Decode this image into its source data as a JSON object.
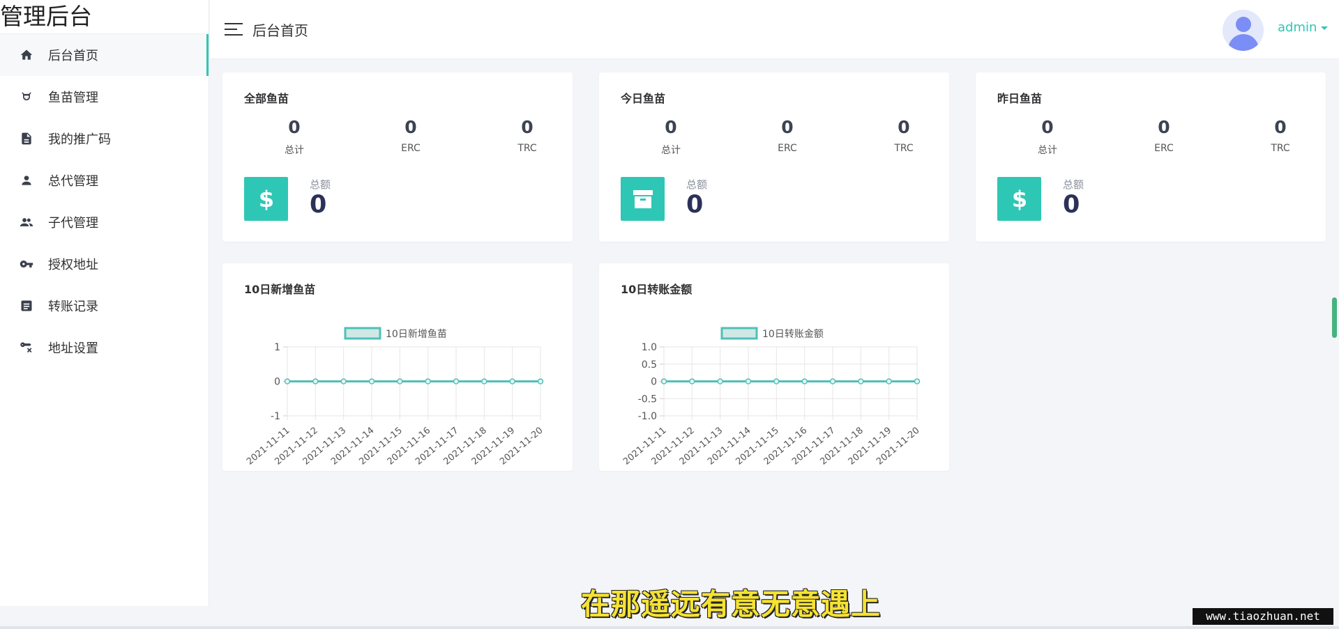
{
  "app": {
    "logo": "管理后台"
  },
  "sidebar": {
    "items": [
      {
        "label": "后台首页",
        "icon": "home-icon",
        "active": true
      },
      {
        "label": "鱼苗管理",
        "icon": "cow-icon"
      },
      {
        "label": "我的推广码",
        "icon": "document-icon"
      },
      {
        "label": "总代管理",
        "icon": "person-icon"
      },
      {
        "label": "子代管理",
        "icon": "people-icon"
      },
      {
        "label": "授权地址",
        "icon": "key-icon"
      },
      {
        "label": "转账记录",
        "icon": "list-box-icon"
      },
      {
        "label": "地址设置",
        "icon": "wrench-cross-icon"
      }
    ]
  },
  "header": {
    "title": "后台首页",
    "user": "admin"
  },
  "colors": {
    "accent": "#2ec7b5",
    "avatar": "#7b8ef5"
  },
  "stat_cards": [
    {
      "title": "全部鱼苗",
      "icon": "dollar-icon",
      "stats": [
        {
          "value": "0",
          "label": "总计"
        },
        {
          "value": "0",
          "label": "ERC"
        },
        {
          "value": "0",
          "label": "TRC"
        }
      ],
      "total_label": "总额",
      "total_value": "0"
    },
    {
      "title": "今日鱼苗",
      "icon": "archive-icon",
      "stats": [
        {
          "value": "0",
          "label": "总计"
        },
        {
          "value": "0",
          "label": "ERC"
        },
        {
          "value": "0",
          "label": "TRC"
        }
      ],
      "total_label": "总额",
      "total_value": "0"
    },
    {
      "title": "昨日鱼苗",
      "icon": "dollar-icon",
      "stats": [
        {
          "value": "0",
          "label": "总计"
        },
        {
          "value": "0",
          "label": "ERC"
        },
        {
          "value": "0",
          "label": "TRC"
        }
      ],
      "total_label": "总额",
      "total_value": "0"
    }
  ],
  "chart_cards": [
    {
      "title": "10日新增鱼苗"
    },
    {
      "title": "10日转账金额"
    }
  ],
  "chart_data": [
    {
      "type": "line",
      "title": "",
      "legend": "top-center",
      "grid": true,
      "x": [
        "2021-11-11",
        "2021-11-12",
        "2021-11-13",
        "2021-11-14",
        "2021-11-15",
        "2021-11-16",
        "2021-11-17",
        "2021-11-18",
        "2021-11-19",
        "2021-11-20"
      ],
      "series": [
        {
          "name": "10日新增鱼苗",
          "values": [
            0,
            0,
            0,
            0,
            0,
            0,
            0,
            0,
            0,
            0
          ]
        }
      ],
      "ylim": [
        -1,
        1
      ],
      "yticks": [
        "1",
        "0",
        "-1"
      ],
      "color": "#4ec1b7"
    },
    {
      "type": "line",
      "title": "",
      "legend": "top-center",
      "grid": true,
      "x": [
        "2021-11-11",
        "2021-11-12",
        "2021-11-13",
        "2021-11-14",
        "2021-11-15",
        "2021-11-16",
        "2021-11-17",
        "2021-11-18",
        "2021-11-19",
        "2021-11-20"
      ],
      "series": [
        {
          "name": "10日转账金额",
          "values": [
            0,
            0,
            0,
            0,
            0,
            0,
            0,
            0,
            0,
            0
          ]
        }
      ],
      "ylim": [
        -1,
        1
      ],
      "yticks": [
        "1.0",
        "0.5",
        "0",
        "-0.5",
        "-1.0"
      ],
      "color": "#4ec1b7"
    }
  ],
  "overlay": {
    "subtitle": "在那遥远有意无意遇上",
    "watermark": "www.tiaozhuan.net"
  }
}
